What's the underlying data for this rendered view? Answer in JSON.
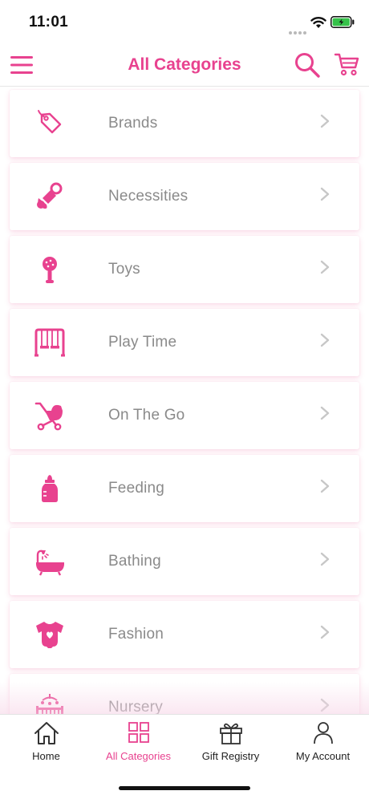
{
  "status_bar": {
    "time": "11:01"
  },
  "nav": {
    "title": "All Categories",
    "menu_icon": "menu-icon",
    "search_icon": "search-icon",
    "cart_icon": "cart-icon"
  },
  "colors": {
    "accent": "#e8428f",
    "label": "#8a8a8a",
    "chevron": "#c7c7c7"
  },
  "categories": [
    {
      "label": "Brands",
      "icon": "tag-icon"
    },
    {
      "label": "Necessities",
      "icon": "pacifier-icon"
    },
    {
      "label": "Toys",
      "icon": "rattle-icon"
    },
    {
      "label": "Play Time",
      "icon": "swing-icon"
    },
    {
      "label": "On The Go",
      "icon": "stroller-icon"
    },
    {
      "label": "Feeding",
      "icon": "bottle-icon"
    },
    {
      "label": "Bathing",
      "icon": "bathtub-icon"
    },
    {
      "label": "Fashion",
      "icon": "onesie-icon"
    },
    {
      "label": "Nursery",
      "icon": "crib-icon"
    }
  ],
  "tabs": [
    {
      "label": "Home",
      "icon": "home-icon",
      "active": false
    },
    {
      "label": "All Categories",
      "icon": "grid-icon",
      "active": true
    },
    {
      "label": "Gift Registry",
      "icon": "gift-icon",
      "active": false
    },
    {
      "label": "My Account",
      "icon": "user-icon",
      "active": false
    }
  ]
}
